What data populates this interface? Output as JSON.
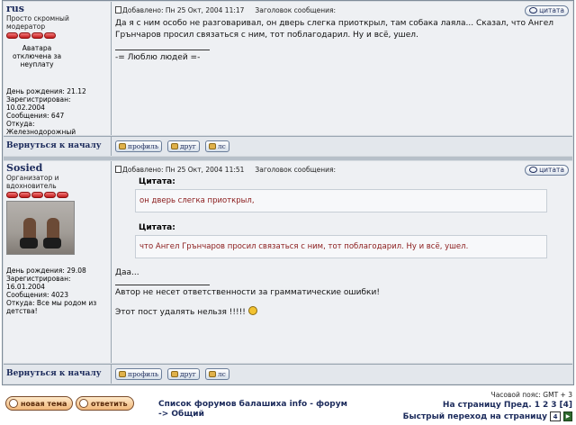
{
  "post1": {
    "username": "rus",
    "rank": "Просто скромный модератор",
    "avatar_note": "Аватара отключена за неуплату",
    "meta": [
      "День рождения: 21.12",
      "Зарегистрирован:",
      "10.02.2004",
      "Сообщения: 647",
      "Откуда:",
      "Железнодорожный"
    ],
    "added": "Добавлено: Пн 25 Окт, 2004 11:17",
    "subject_label": "Заголовок сообщения:",
    "quote_label": "цитата",
    "text": "Да я с ним особо не разговаривал, он дверь слегка приоткрыл, там собака лаяла... Сказал, что Ангел Грънчаров просил связаться с ним, тот поблагодарил. Ну и всё, ушел.",
    "signature": "-= Люблю людей =-"
  },
  "post2": {
    "username": "Sosied",
    "rank": "Организатор и вдохновитель",
    "meta": [
      "День рождения: 29.08",
      "Зарегистрирован:",
      "16.01.2004",
      "Сообщения: 4023",
      "Откуда: Все мы родом из детства!"
    ],
    "added": "Добавлено: Пн 25 Окт, 2004 11:51",
    "subject_label": "Заголовок сообщения:",
    "quote_label": "цитата",
    "quotes": [
      {
        "title": "Цитата:",
        "text": "он дверь слегка приоткрыл,"
      },
      {
        "title": "Цитата:",
        "text": "что Ангел Грънчаров просил связаться с ним, тот поблагодарил. Ну и всё, ушел."
      }
    ],
    "reply": "Даа...",
    "signature1": "Автор не несет ответственности за грамматические ошибки!",
    "signature2": "Этот пост удалять нельзя !!!!!"
  },
  "footer": {
    "back_to_top": "Вернуться к началу",
    "profile": "профиль",
    "friend": "друг",
    "pm": "лс"
  },
  "bottom": {
    "new_topic": "новая тема",
    "reply": "ответить",
    "forum_path": "Список форумов балашиха info - форум -> Общий",
    "timezone": "Часовой пояс: GMT + 3",
    "pages_label": "На страницу Пред.",
    "pages": [
      "1",
      "2",
      "3",
      "[4]"
    ],
    "quick_jump": "Быстрый переход на страницу",
    "jump_value": "4"
  }
}
